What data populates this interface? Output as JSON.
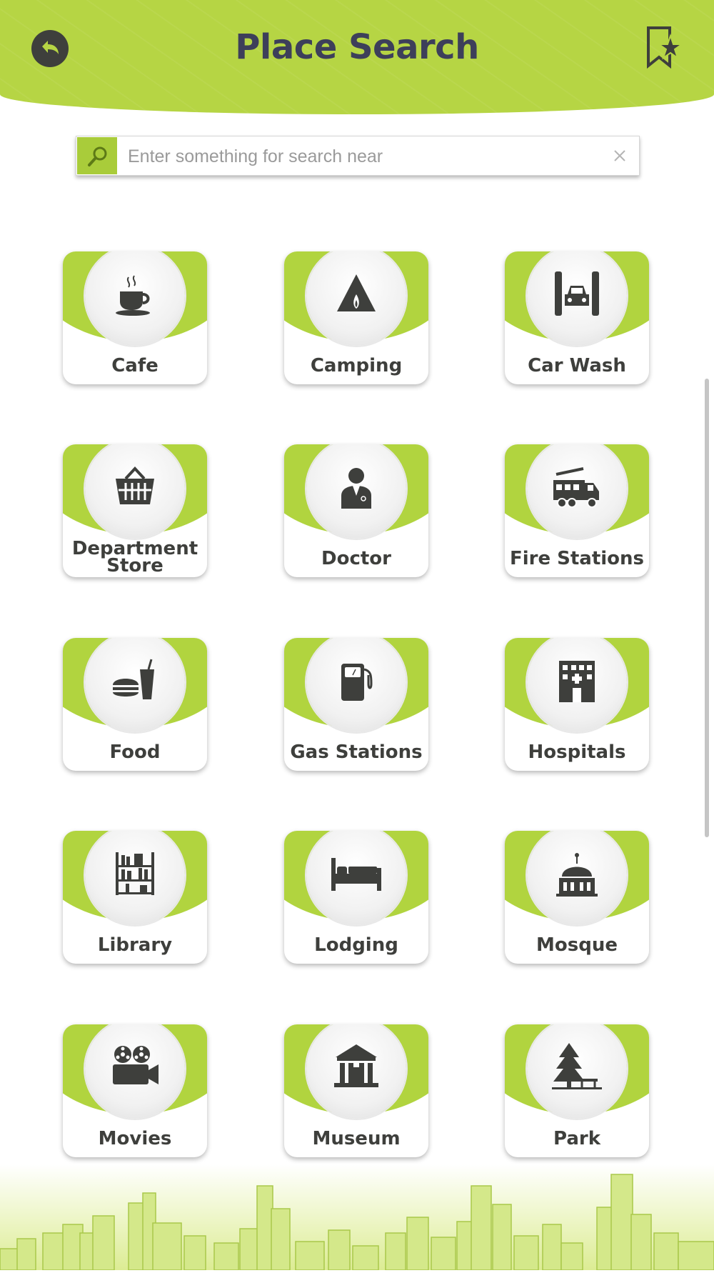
{
  "header": {
    "title": "Place Search",
    "back_icon": "back-arrow-icon",
    "bookmark_icon": "bookmark-star-icon"
  },
  "search": {
    "placeholder": "Enter something for search near",
    "value": "",
    "icon": "search-icon",
    "clear_icon": "close-icon"
  },
  "colors": {
    "accent": "#b1d43f",
    "dark": "#3e3f3c",
    "title": "#3d3f5a"
  },
  "categories": [
    {
      "label": "Cafe",
      "icon": "coffee-cup-icon"
    },
    {
      "label": "Camping",
      "icon": "tent-icon"
    },
    {
      "label": "Car Wash",
      "icon": "car-wash-icon"
    },
    {
      "label": "Department Store",
      "icon": "shopping-basket-icon"
    },
    {
      "label": "Doctor",
      "icon": "doctor-icon"
    },
    {
      "label": "Fire Stations",
      "icon": "fire-truck-icon"
    },
    {
      "label": "Food",
      "icon": "burger-drink-icon"
    },
    {
      "label": "Gas Stations",
      "icon": "fuel-pump-icon"
    },
    {
      "label": "Hospitals",
      "icon": "hospital-icon"
    },
    {
      "label": "Library",
      "icon": "bookshelf-icon"
    },
    {
      "label": "Lodging",
      "icon": "bed-icon"
    },
    {
      "label": "Mosque",
      "icon": "mosque-icon"
    },
    {
      "label": "Movies",
      "icon": "film-camera-icon"
    },
    {
      "label": "Museum",
      "icon": "museum-icon"
    },
    {
      "label": "Park",
      "icon": "tree-bench-icon"
    }
  ]
}
